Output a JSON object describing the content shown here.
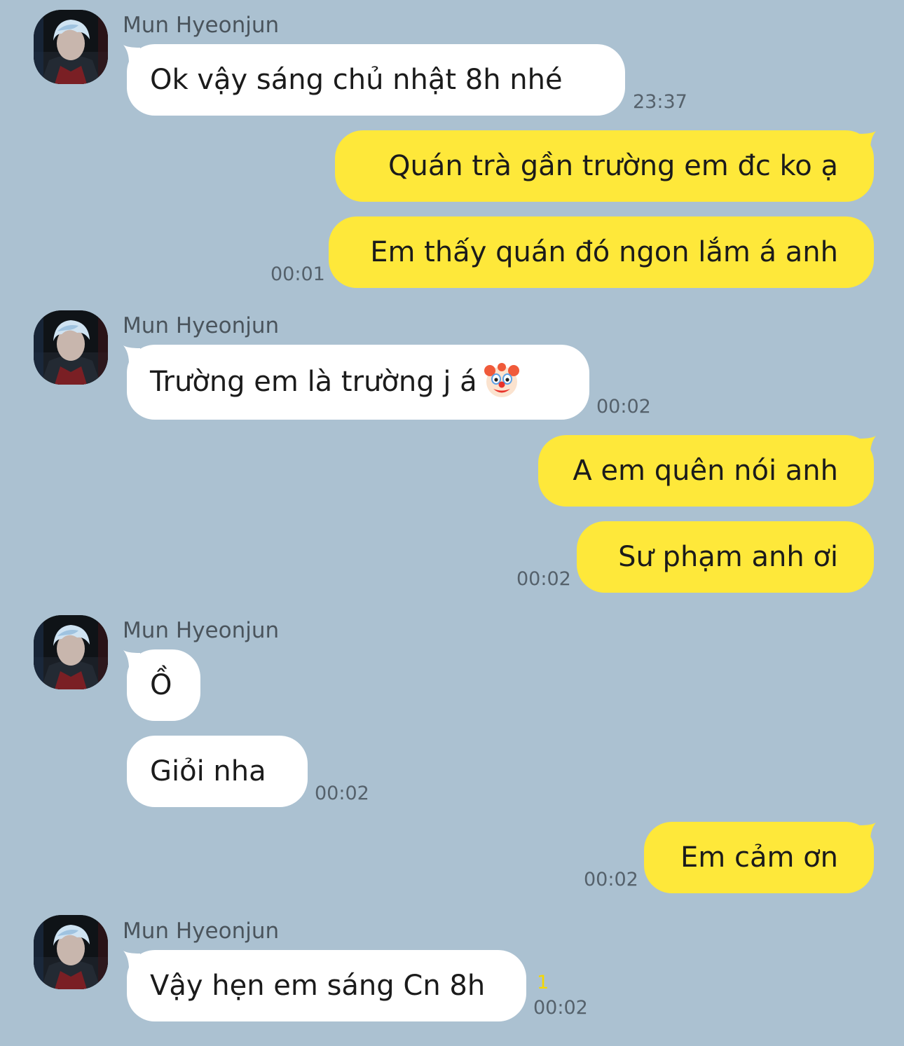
{
  "colors": {
    "background": "#abc1d1",
    "incoming_bubble": "#ffffff",
    "outgoing_bubble": "#fee83a",
    "unread_count": "#f5d800"
  },
  "contact": {
    "name": "Mun Hyeonjun"
  },
  "groups": [
    {
      "sender": "Mun Hyeonjun",
      "messages": [
        {
          "text": "Ok vậy sáng chủ nhật 8h nhé",
          "time": "23:37"
        }
      ]
    },
    {
      "sender": "me",
      "messages": [
        {
          "text": "Quán trà gần trường em đc ko ạ"
        },
        {
          "text": "Em thấy quán đó ngon lắm á anh",
          "time": "00:01"
        }
      ]
    },
    {
      "sender": "Mun Hyeonjun",
      "messages": [
        {
          "text": "Trường em là trường j á",
          "emoji": "clown-face",
          "time": "00:02"
        }
      ]
    },
    {
      "sender": "me",
      "messages": [
        {
          "text": "A em quên nói anh"
        },
        {
          "text": "Sư phạm anh ơi",
          "time": "00:02"
        }
      ]
    },
    {
      "sender": "Mun Hyeonjun",
      "messages": [
        {
          "text": "Ồ"
        },
        {
          "text": "Giỏi nha",
          "time": "00:02"
        }
      ]
    },
    {
      "sender": "me",
      "messages": [
        {
          "text": "Em cảm ơn",
          "time": "00:02"
        }
      ]
    },
    {
      "sender": "Mun Hyeonjun",
      "messages": [
        {
          "text": "Vậy hẹn em sáng Cn 8h",
          "time": "00:02",
          "unread": "1"
        }
      ]
    }
  ]
}
